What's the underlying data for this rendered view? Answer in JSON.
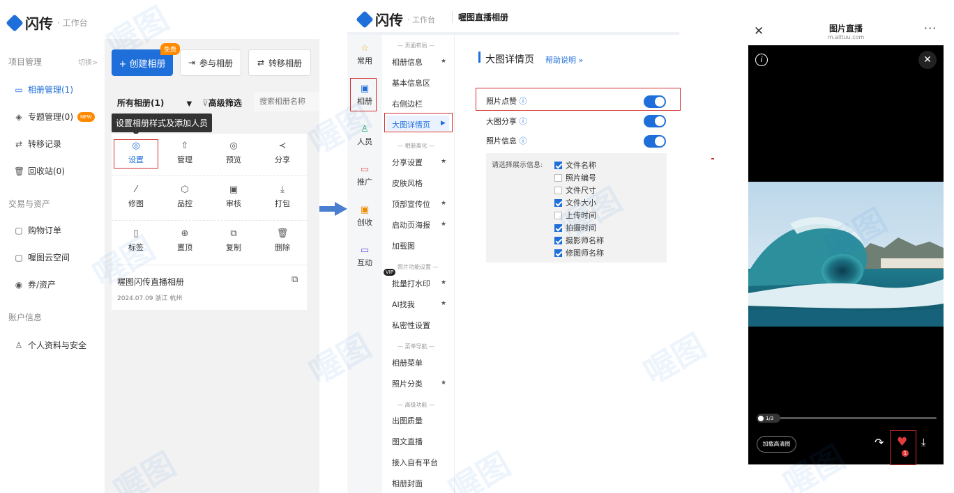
{
  "panel1": {
    "brand": "闪传",
    "brand_sub": "· 工作台",
    "sidebar": {
      "group1": "项目管理",
      "switch": "切换>",
      "items1": [
        {
          "label": "相册管理(1)",
          "icon": "album-icon"
        },
        {
          "label": "专题管理(0)",
          "icon": "topic-icon"
        },
        {
          "label": "转移记录",
          "icon": "transfer-icon"
        },
        {
          "label": "回收站(0)",
          "icon": "trash-icon"
        }
      ],
      "new_badge": "NEW",
      "group2": "交易与资产",
      "items2": [
        {
          "label": "购物订单",
          "icon": "cart-icon"
        },
        {
          "label": "喔图云空间",
          "icon": "cloud-icon"
        },
        {
          "label": "券/资产",
          "icon": "coupon-icon"
        }
      ],
      "group3": "账户信息",
      "items3": [
        {
          "label": "个人资料与安全",
          "icon": "user-icon"
        }
      ]
    },
    "create_button": "+ 创建相册",
    "free_badge": "免费",
    "join_button": "参与相册",
    "transfer_button": "转移相册",
    "filter_all": "所有相册(1)",
    "filter_advanced": "高级筛选",
    "search_placeholder": "搜索相册名称",
    "tooltip": "设置相册样式及添加人员",
    "actions": [
      {
        "label": "设置",
        "icon": "settings-icon"
      },
      {
        "label": "管理",
        "icon": "manage-icon"
      },
      {
        "label": "预览",
        "icon": "preview-icon"
      },
      {
        "label": "分享",
        "icon": "share-icon"
      },
      {
        "label": "修图",
        "icon": "retouch-icon"
      },
      {
        "label": "品控",
        "icon": "quality-icon"
      },
      {
        "label": "审核",
        "icon": "review-icon"
      },
      {
        "label": "打包",
        "icon": "download-icon"
      },
      {
        "label": "标签",
        "icon": "tag-icon"
      },
      {
        "label": "置顶",
        "icon": "pin-top-icon"
      },
      {
        "label": "复制",
        "icon": "copy-icon"
      },
      {
        "label": "删除",
        "icon": "delete-icon"
      }
    ],
    "album_title": "喔图闪传直播相册",
    "album_meta": "2024.07.09 浙江 杭州"
  },
  "panel2": {
    "brand": "闪传",
    "brand_sub": "· 工作台",
    "album_name": "喔图直播相册",
    "nav": [
      {
        "label": "常用",
        "icon": "star-icon"
      },
      {
        "label": "相册",
        "icon": "album-icon"
      },
      {
        "label": "人员",
        "icon": "people-icon"
      },
      {
        "label": "推广",
        "icon": "promote-icon"
      },
      {
        "label": "创收",
        "icon": "revenue-icon"
      },
      {
        "label": "互动",
        "icon": "interact-icon"
      }
    ],
    "menu_headers": [
      "— 页面布局 —",
      "— 相册美化 —",
      "照片功能设置 —",
      "— 菜单导航 —",
      "— 高级功能 —"
    ],
    "menu": {
      "a": [
        "相册信息",
        "基本信息区",
        "右侧边栏",
        "大图详情页"
      ],
      "b": [
        "分享设置",
        "皮肤风格",
        "顶部宣传位",
        "启动页海报",
        "加载图"
      ],
      "c": [
        "批量打水印",
        "AI找我",
        "私密性设置"
      ],
      "d": [
        "相册菜单",
        "照片分类"
      ],
      "e": [
        "出图质量",
        "图文直播",
        "接入自有平台",
        "相册封面"
      ]
    },
    "vip_badge": "VIP",
    "section_title": "大图详情页",
    "help_link": "帮助说明 »",
    "toggles": [
      "照片点赞",
      "大图分享",
      "照片信息"
    ],
    "info_label": "请选择展示信息:",
    "options": [
      {
        "label": "文件名称",
        "checked": true
      },
      {
        "label": "照片编号",
        "checked": false
      },
      {
        "label": "文件尺寸",
        "checked": false
      },
      {
        "label": "文件大小",
        "checked": true
      },
      {
        "label": "上传时间",
        "checked": false
      },
      {
        "label": "拍摄时间",
        "checked": true
      },
      {
        "label": "摄影师名称",
        "checked": true
      },
      {
        "label": "修图师名称",
        "checked": true
      }
    ]
  },
  "panel3": {
    "title": "图片直播",
    "url": "m.alltuu.com",
    "page_indicator": "1/3",
    "hd_button": "加载高清图",
    "like_count": "1"
  },
  "watermark": "喔图"
}
